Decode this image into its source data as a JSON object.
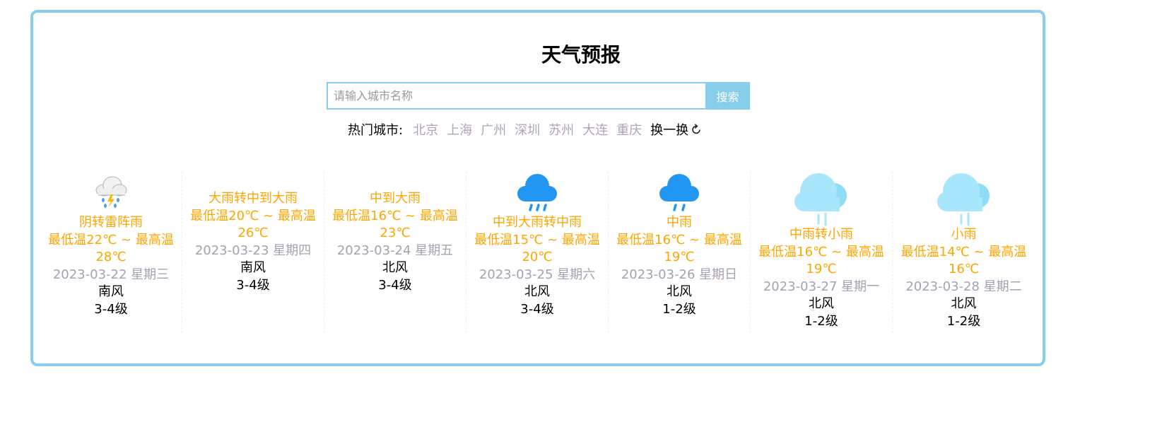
{
  "title": "天气预报",
  "search": {
    "placeholder": "请输入城市名称",
    "button_label": "搜索"
  },
  "hot_cities": {
    "label": "热门城市:",
    "cities": [
      "北京",
      "上海",
      "广州",
      "深圳",
      "苏州",
      "大连",
      "重庆"
    ],
    "refresh_label": "换一换"
  },
  "colors": {
    "border": "#87ceeb",
    "accent_orange": "#ffa500",
    "muted": "#a89fb2"
  },
  "forecast": [
    {
      "icon": "thunder-shower-icon",
      "weather": "阴转雷阵雨",
      "temp_line1": "最低温22℃ ~ 最高温",
      "temp_line2": "28℃",
      "date": "2023-03-22 星期三",
      "wind_dir": "南风",
      "wind_level": "3-4级"
    },
    {
      "icon": "",
      "weather": "大雨转中到大雨",
      "temp_line1": "最低温20℃ ~ 最高温",
      "temp_line2": "26℃",
      "date": "2023-03-23 星期四",
      "wind_dir": "南风",
      "wind_level": "3-4级"
    },
    {
      "icon": "",
      "weather": "中到大雨",
      "temp_line1": "最低温16℃ ~ 最高温",
      "temp_line2": "23℃",
      "date": "2023-03-24 星期五",
      "wind_dir": "北风",
      "wind_level": "3-4级"
    },
    {
      "icon": "moderate-rain-icon",
      "weather": "中到大雨转中雨",
      "temp_line1": "最低温15℃ ~ 最高温",
      "temp_line2": "20℃",
      "date": "2023-03-25 星期六",
      "wind_dir": "北风",
      "wind_level": "3-4级"
    },
    {
      "icon": "moderate-rain-icon",
      "weather": "中雨",
      "temp_line1": "最低温16℃ ~ 最高温",
      "temp_line2": "19℃",
      "date": "2023-03-26 星期日",
      "wind_dir": "北风",
      "wind_level": "1-2级"
    },
    {
      "icon": "light-rain-icon",
      "weather": "中雨转小雨",
      "temp_line1": "最低温16℃ ~ 最高温",
      "temp_line2": "19℃",
      "date": "2023-03-27 星期一",
      "wind_dir": "北风",
      "wind_level": "1-2级"
    },
    {
      "icon": "light-rain-icon",
      "weather": "小雨",
      "temp_line1": "最低温14℃ ~ 最高温",
      "temp_line2": "16℃",
      "date": "2023-03-28 星期二",
      "wind_dir": "北风",
      "wind_level": "1-2级"
    }
  ]
}
